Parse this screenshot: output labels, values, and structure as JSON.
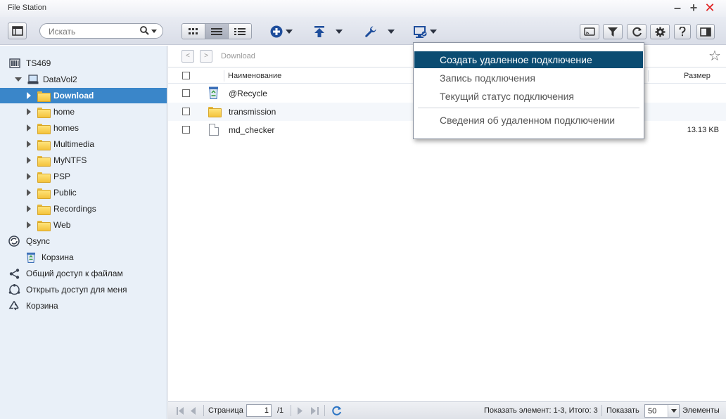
{
  "window": {
    "title": "File Station"
  },
  "toolbar": {
    "search_placeholder": "Искать"
  },
  "sidebar": {
    "items": [
      {
        "label": "TS469"
      },
      {
        "label": "DataVol2"
      },
      {
        "label": "Download"
      },
      {
        "label": "home"
      },
      {
        "label": "homes"
      },
      {
        "label": "Multimedia"
      },
      {
        "label": "MyNTFS"
      },
      {
        "label": "PSP"
      },
      {
        "label": "Public"
      },
      {
        "label": "Recordings"
      },
      {
        "label": "Web"
      },
      {
        "label": "Qsync"
      },
      {
        "label": "Корзина"
      },
      {
        "label": "Общий доступ к файлам"
      },
      {
        "label": "Открыть доступ для меня"
      },
      {
        "label": "Корзина"
      }
    ]
  },
  "main": {
    "path": "Download",
    "columns": {
      "name": "Наименование",
      "size": "Размер"
    },
    "rows": [
      {
        "name": "@Recycle",
        "size": ""
      },
      {
        "name": "transmission",
        "size": ""
      },
      {
        "name": "md_checker",
        "size": "13.13 KB"
      }
    ]
  },
  "dropdown": {
    "items": [
      {
        "label": "Создать удаленное подключение"
      },
      {
        "label": "Запись подключения"
      },
      {
        "label": "Текущий статус подключения"
      },
      {
        "label": "Сведения об удаленном подключении"
      }
    ]
  },
  "statusbar": {
    "page_label": "Страница",
    "page_value": "1",
    "page_total": "/1",
    "summary": "Показать элемент: 1-3, Итого: 3",
    "per_page_label": "Показать",
    "per_page_value": "50",
    "items_label": "Элементы"
  },
  "colors": {
    "selection": "#3a86c9",
    "menu_active": "#0b4c72",
    "sidebar_bg": "#e9f0f8",
    "close": "#e02020"
  }
}
